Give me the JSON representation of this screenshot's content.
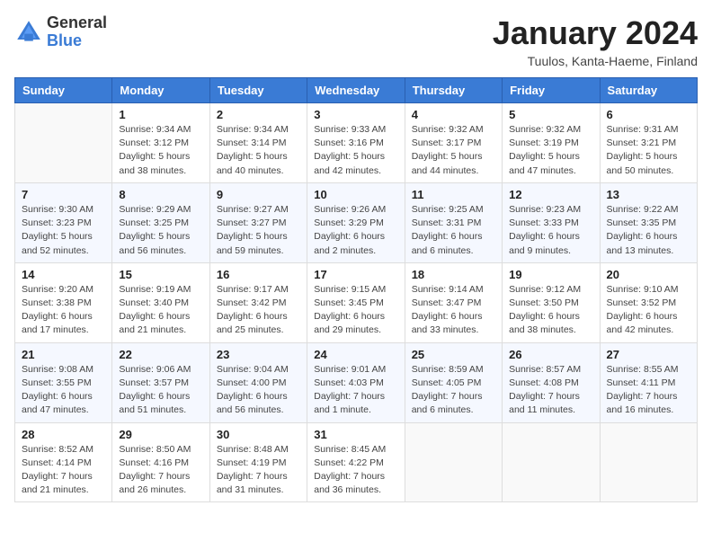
{
  "header": {
    "logo": {
      "general": "General",
      "blue": "Blue"
    },
    "title": "January 2024",
    "subtitle": "Tuulos, Kanta-Haeme, Finland"
  },
  "calendar": {
    "days_of_week": [
      "Sunday",
      "Monday",
      "Tuesday",
      "Wednesday",
      "Thursday",
      "Friday",
      "Saturday"
    ],
    "weeks": [
      [
        {
          "day": "",
          "sunrise": "",
          "sunset": "",
          "daylight": ""
        },
        {
          "day": "1",
          "sunrise": "Sunrise: 9:34 AM",
          "sunset": "Sunset: 3:12 PM",
          "daylight": "Daylight: 5 hours and 38 minutes."
        },
        {
          "day": "2",
          "sunrise": "Sunrise: 9:34 AM",
          "sunset": "Sunset: 3:14 PM",
          "daylight": "Daylight: 5 hours and 40 minutes."
        },
        {
          "day": "3",
          "sunrise": "Sunrise: 9:33 AM",
          "sunset": "Sunset: 3:16 PM",
          "daylight": "Daylight: 5 hours and 42 minutes."
        },
        {
          "day": "4",
          "sunrise": "Sunrise: 9:32 AM",
          "sunset": "Sunset: 3:17 PM",
          "daylight": "Daylight: 5 hours and 44 minutes."
        },
        {
          "day": "5",
          "sunrise": "Sunrise: 9:32 AM",
          "sunset": "Sunset: 3:19 PM",
          "daylight": "Daylight: 5 hours and 47 minutes."
        },
        {
          "day": "6",
          "sunrise": "Sunrise: 9:31 AM",
          "sunset": "Sunset: 3:21 PM",
          "daylight": "Daylight: 5 hours and 50 minutes."
        }
      ],
      [
        {
          "day": "7",
          "sunrise": "Sunrise: 9:30 AM",
          "sunset": "Sunset: 3:23 PM",
          "daylight": "Daylight: 5 hours and 52 minutes."
        },
        {
          "day": "8",
          "sunrise": "Sunrise: 9:29 AM",
          "sunset": "Sunset: 3:25 PM",
          "daylight": "Daylight: 5 hours and 56 minutes."
        },
        {
          "day": "9",
          "sunrise": "Sunrise: 9:27 AM",
          "sunset": "Sunset: 3:27 PM",
          "daylight": "Daylight: 5 hours and 59 minutes."
        },
        {
          "day": "10",
          "sunrise": "Sunrise: 9:26 AM",
          "sunset": "Sunset: 3:29 PM",
          "daylight": "Daylight: 6 hours and 2 minutes."
        },
        {
          "day": "11",
          "sunrise": "Sunrise: 9:25 AM",
          "sunset": "Sunset: 3:31 PM",
          "daylight": "Daylight: 6 hours and 6 minutes."
        },
        {
          "day": "12",
          "sunrise": "Sunrise: 9:23 AM",
          "sunset": "Sunset: 3:33 PM",
          "daylight": "Daylight: 6 hours and 9 minutes."
        },
        {
          "day": "13",
          "sunrise": "Sunrise: 9:22 AM",
          "sunset": "Sunset: 3:35 PM",
          "daylight": "Daylight: 6 hours and 13 minutes."
        }
      ],
      [
        {
          "day": "14",
          "sunrise": "Sunrise: 9:20 AM",
          "sunset": "Sunset: 3:38 PM",
          "daylight": "Daylight: 6 hours and 17 minutes."
        },
        {
          "day": "15",
          "sunrise": "Sunrise: 9:19 AM",
          "sunset": "Sunset: 3:40 PM",
          "daylight": "Daylight: 6 hours and 21 minutes."
        },
        {
          "day": "16",
          "sunrise": "Sunrise: 9:17 AM",
          "sunset": "Sunset: 3:42 PM",
          "daylight": "Daylight: 6 hours and 25 minutes."
        },
        {
          "day": "17",
          "sunrise": "Sunrise: 9:15 AM",
          "sunset": "Sunset: 3:45 PM",
          "daylight": "Daylight: 6 hours and 29 minutes."
        },
        {
          "day": "18",
          "sunrise": "Sunrise: 9:14 AM",
          "sunset": "Sunset: 3:47 PM",
          "daylight": "Daylight: 6 hours and 33 minutes."
        },
        {
          "day": "19",
          "sunrise": "Sunrise: 9:12 AM",
          "sunset": "Sunset: 3:50 PM",
          "daylight": "Daylight: 6 hours and 38 minutes."
        },
        {
          "day": "20",
          "sunrise": "Sunrise: 9:10 AM",
          "sunset": "Sunset: 3:52 PM",
          "daylight": "Daylight: 6 hours and 42 minutes."
        }
      ],
      [
        {
          "day": "21",
          "sunrise": "Sunrise: 9:08 AM",
          "sunset": "Sunset: 3:55 PM",
          "daylight": "Daylight: 6 hours and 47 minutes."
        },
        {
          "day": "22",
          "sunrise": "Sunrise: 9:06 AM",
          "sunset": "Sunset: 3:57 PM",
          "daylight": "Daylight: 6 hours and 51 minutes."
        },
        {
          "day": "23",
          "sunrise": "Sunrise: 9:04 AM",
          "sunset": "Sunset: 4:00 PM",
          "daylight": "Daylight: 6 hours and 56 minutes."
        },
        {
          "day": "24",
          "sunrise": "Sunrise: 9:01 AM",
          "sunset": "Sunset: 4:03 PM",
          "daylight": "Daylight: 7 hours and 1 minute."
        },
        {
          "day": "25",
          "sunrise": "Sunrise: 8:59 AM",
          "sunset": "Sunset: 4:05 PM",
          "daylight": "Daylight: 7 hours and 6 minutes."
        },
        {
          "day": "26",
          "sunrise": "Sunrise: 8:57 AM",
          "sunset": "Sunset: 4:08 PM",
          "daylight": "Daylight: 7 hours and 11 minutes."
        },
        {
          "day": "27",
          "sunrise": "Sunrise: 8:55 AM",
          "sunset": "Sunset: 4:11 PM",
          "daylight": "Daylight: 7 hours and 16 minutes."
        }
      ],
      [
        {
          "day": "28",
          "sunrise": "Sunrise: 8:52 AM",
          "sunset": "Sunset: 4:14 PM",
          "daylight": "Daylight: 7 hours and 21 minutes."
        },
        {
          "day": "29",
          "sunrise": "Sunrise: 8:50 AM",
          "sunset": "Sunset: 4:16 PM",
          "daylight": "Daylight: 7 hours and 26 minutes."
        },
        {
          "day": "30",
          "sunrise": "Sunrise: 8:48 AM",
          "sunset": "Sunset: 4:19 PM",
          "daylight": "Daylight: 7 hours and 31 minutes."
        },
        {
          "day": "31",
          "sunrise": "Sunrise: 8:45 AM",
          "sunset": "Sunset: 4:22 PM",
          "daylight": "Daylight: 7 hours and 36 minutes."
        },
        {
          "day": "",
          "sunrise": "",
          "sunset": "",
          "daylight": ""
        },
        {
          "day": "",
          "sunrise": "",
          "sunset": "",
          "daylight": ""
        },
        {
          "day": "",
          "sunrise": "",
          "sunset": "",
          "daylight": ""
        }
      ]
    ]
  }
}
